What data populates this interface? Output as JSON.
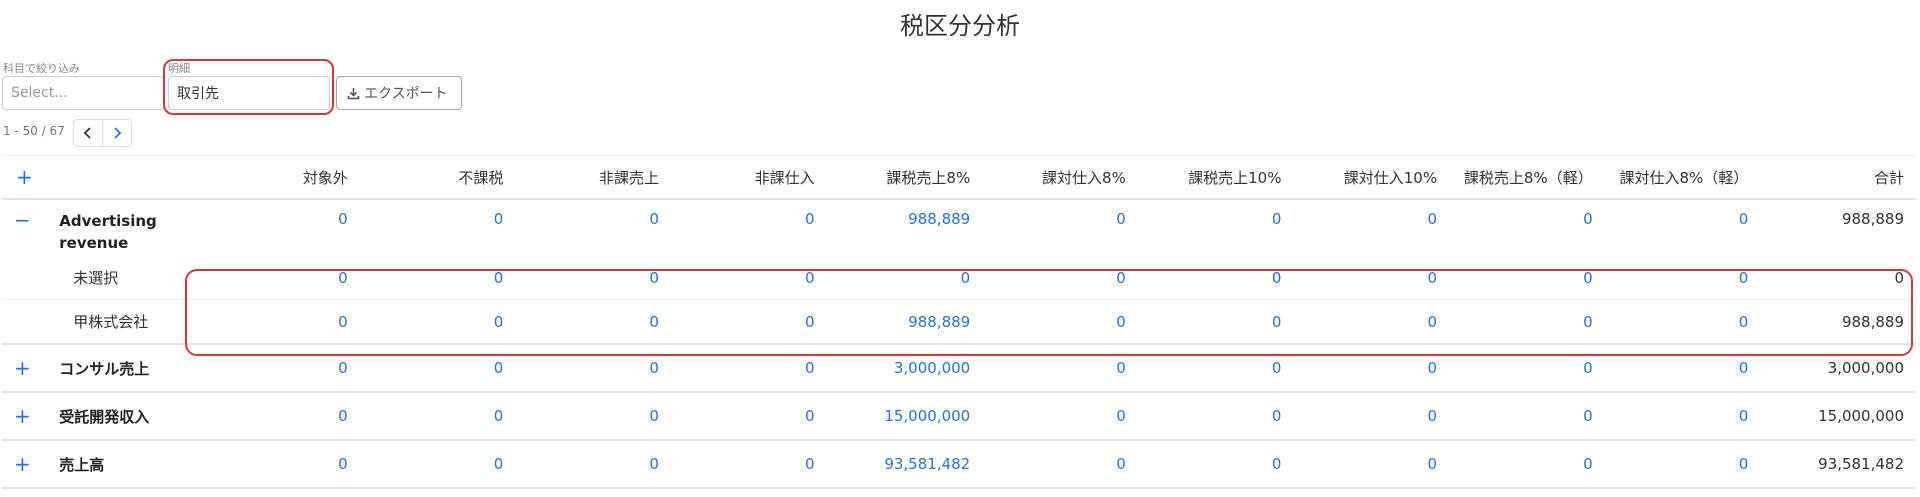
{
  "page": {
    "title": "税区分分析"
  },
  "filters": {
    "account_label": "科目で絞り込み",
    "account_placeholder": "Select...",
    "detail_label": "明細",
    "detail_value": "取引先",
    "export_label": "エクスポート"
  },
  "pagination": {
    "range_text": "1 - 50 / 67"
  },
  "table": {
    "columns": [
      "対象外",
      "不課税",
      "非課売上",
      "非課仕入",
      "課税売上8%",
      "課対仕入8%",
      "課税売上10%",
      "課対仕入10%",
      "課税売上8%（軽）",
      "課対仕入8%（軽）",
      "合計"
    ],
    "header_toggle": "+",
    "rows": [
      {
        "toggle": "−",
        "name": "Advertising revenue",
        "values": [
          "0",
          "0",
          "0",
          "0",
          "988,889",
          "0",
          "0",
          "0",
          "0",
          "0",
          "988,889"
        ],
        "children": [
          {
            "name": "未選択",
            "values": [
              "0",
              "0",
              "0",
              "0",
              "0",
              "0",
              "0",
              "0",
              "0",
              "0",
              "0"
            ]
          },
          {
            "name": "甲株式会社",
            "values": [
              "0",
              "0",
              "0",
              "0",
              "988,889",
              "0",
              "0",
              "0",
              "0",
              "0",
              "988,889"
            ]
          }
        ]
      },
      {
        "toggle": "+",
        "name": "コンサル売上",
        "values": [
          "0",
          "0",
          "0",
          "0",
          "3,000,000",
          "0",
          "0",
          "0",
          "0",
          "0",
          "3,000,000"
        ]
      },
      {
        "toggle": "+",
        "name": "受託開発収入",
        "values": [
          "0",
          "0",
          "0",
          "0",
          "15,000,000",
          "0",
          "0",
          "0",
          "0",
          "0",
          "15,000,000"
        ]
      },
      {
        "toggle": "+",
        "name": "売上高",
        "values": [
          "0",
          "0",
          "0",
          "0",
          "93,581,482",
          "0",
          "0",
          "0",
          "0",
          "0",
          "93,581,482"
        ]
      }
    ]
  },
  "icons": {
    "download": "download-icon",
    "prev": "chevron-left-icon",
    "next": "chevron-right-icon"
  },
  "colors": {
    "accent": "#1a73e8",
    "highlight": "#e0362a"
  }
}
